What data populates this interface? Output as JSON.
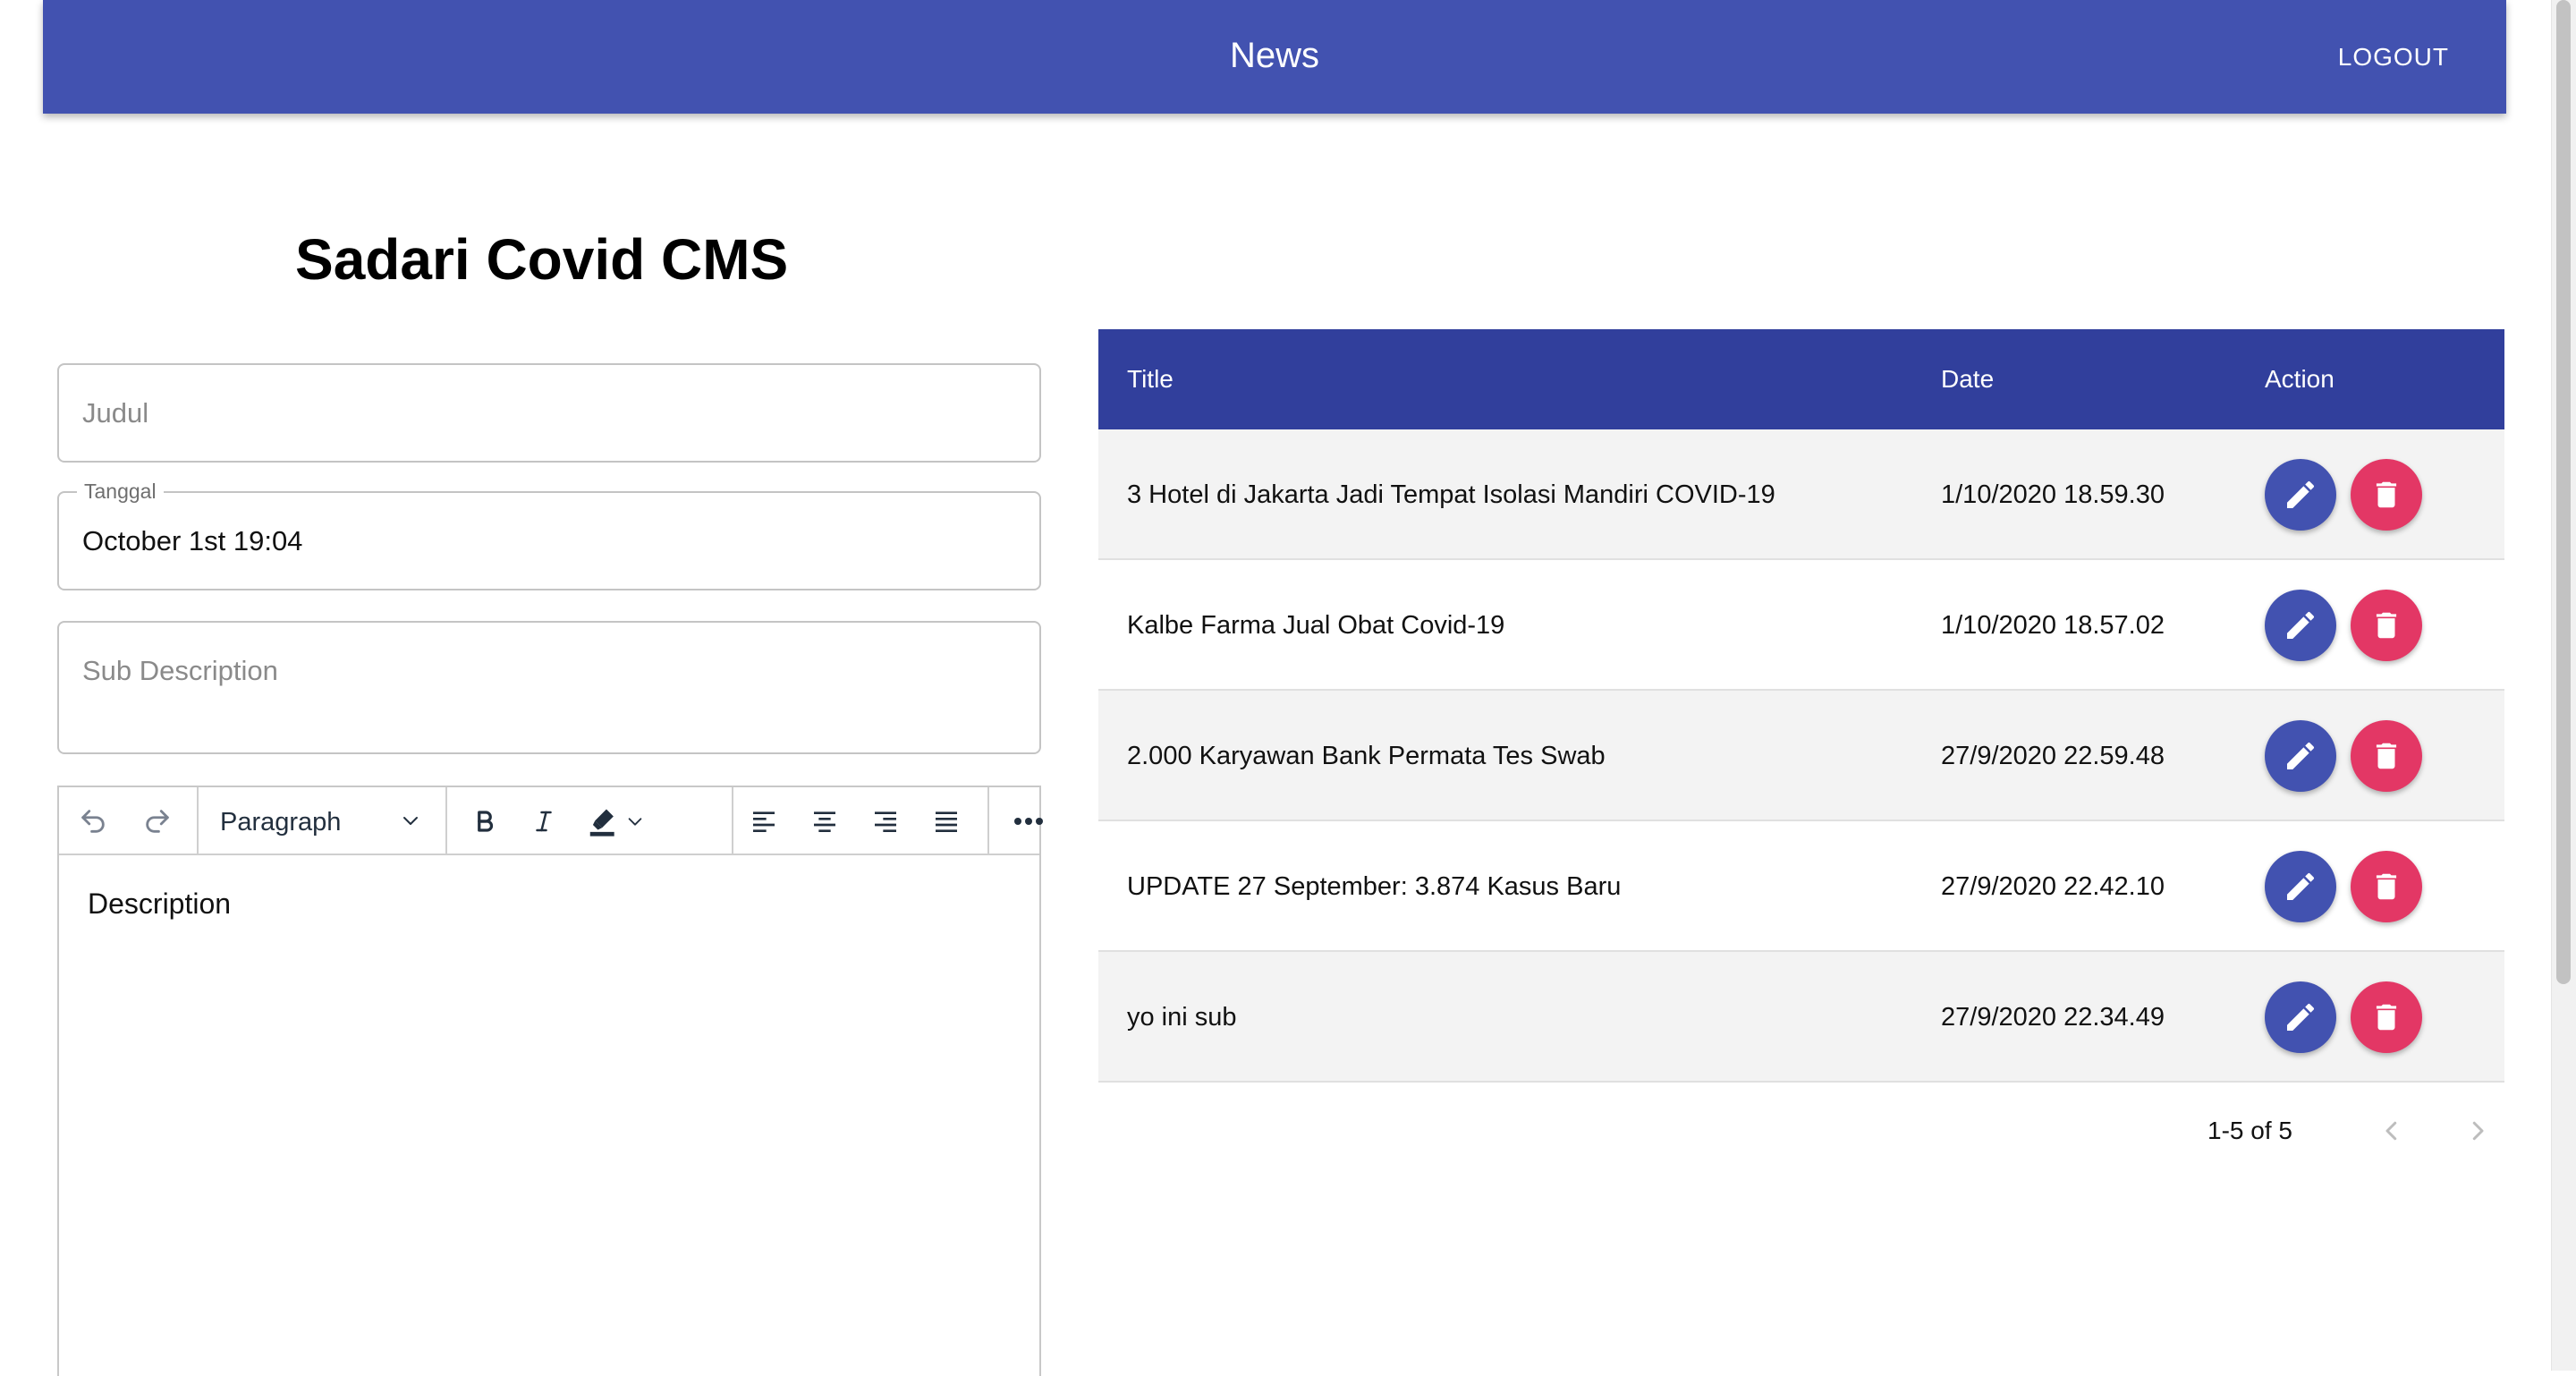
{
  "appbar": {
    "title": "News",
    "logout_label": "LOGOUT",
    "background": "#4252b0"
  },
  "page": {
    "title": "Sadari Covid CMS"
  },
  "form": {
    "judul_placeholder": "Judul",
    "tanggal_label": "Tanggal",
    "tanggal_value": "October 1st 19:04",
    "sub_description_placeholder": "Sub Description"
  },
  "editor": {
    "format_value": "Paragraph",
    "body_placeholder": "Description",
    "toolbar_icons": [
      "undo-icon",
      "redo-icon",
      "chevron-down-icon",
      "bold-icon",
      "italic-icon",
      "highlight-icon",
      "align-left-icon",
      "align-center-icon",
      "align-right-icon",
      "align-justify-icon",
      "more-icon"
    ]
  },
  "table": {
    "header_background": "#313f9c",
    "columns": [
      "Title",
      "Date",
      "Action"
    ],
    "rows": [
      {
        "title": "3 Hotel di Jakarta Jadi Tempat Isolasi Mandiri COVID-19",
        "date": "1/10/2020 18.59.30"
      },
      {
        "title": "Kalbe Farma Jual Obat Covid-19",
        "date": "1/10/2020 18.57.02"
      },
      {
        "title": "2.000 Karyawan Bank Permata Tes Swab",
        "date": "27/9/2020 22.59.48"
      },
      {
        "title": "UPDATE 27 September: 3.874 Kasus Baru",
        "date": "27/9/2020 22.42.10"
      },
      {
        "title": "yo ini sub",
        "date": "27/9/2020 22.34.49"
      }
    ],
    "edit_color": "#4252b0",
    "delete_color": "#e33765"
  },
  "pagination": {
    "label": "1-5 of 5"
  }
}
